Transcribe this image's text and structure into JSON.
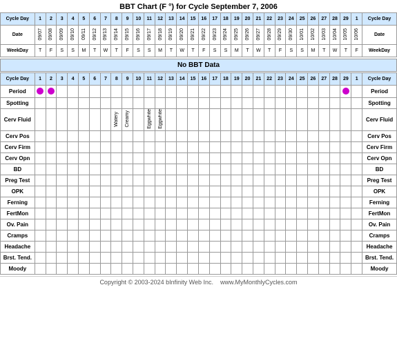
{
  "title": "BBT Chart (F °) for Cycle September 7, 2006",
  "top_section": {
    "cycle_day_label": "Cycle Day",
    "date_label": "Date",
    "weekday_label": "WeekDay",
    "cycle_days": [
      "1",
      "2",
      "3",
      "4",
      "5",
      "6",
      "7",
      "8",
      "9",
      "10",
      "11",
      "12",
      "13",
      "14",
      "15",
      "16",
      "17",
      "18",
      "19",
      "20",
      "21",
      "22",
      "23",
      "24",
      "25",
      "26",
      "27",
      "28",
      "29",
      "1"
    ],
    "dates": [
      "09/07",
      "09/08",
      "09/09",
      "09/10",
      "09/11",
      "09/12",
      "09/13",
      "09/14",
      "09/15",
      "09/16",
      "09/17",
      "09/18",
      "09/19",
      "09/20",
      "09/21",
      "09/22",
      "09/23",
      "09/24",
      "09/25",
      "09/26",
      "09/27",
      "09/28",
      "09/29",
      "09/30",
      "10/01",
      "10/02",
      "10/03",
      "10/04",
      "10/05",
      "10/06"
    ],
    "weekdays": [
      "T",
      "F",
      "S",
      "S",
      "M",
      "T",
      "W",
      "T",
      "F",
      "S",
      "S",
      "M",
      "T",
      "W",
      "T",
      "F",
      "S",
      "S",
      "M",
      "T",
      "W",
      "T",
      "F",
      "S",
      "S",
      "M",
      "T",
      "W",
      "T",
      "F"
    ]
  },
  "no_bbt": "No BBT Data",
  "bottom_section": {
    "cycle_days": [
      "1",
      "2",
      "3",
      "4",
      "5",
      "6",
      "7",
      "8",
      "9",
      "10",
      "11",
      "12",
      "13",
      "14",
      "15",
      "16",
      "17",
      "18",
      "19",
      "20",
      "21",
      "22",
      "23",
      "24",
      "25",
      "26",
      "27",
      "28",
      "29",
      "1"
    ],
    "rows": {
      "period": {
        "label": "Period",
        "dots": [
          0,
          1
        ],
        "last_dot": 29
      },
      "spotting": {
        "label": "Spotting"
      },
      "cerv_fluid": {
        "label": "Cerv Fluid",
        "values": {
          "7": "Watery",
          "8": "Creamy",
          "10": "Eggwhite",
          "11": "Eggwhite"
        }
      },
      "cerv_pos": {
        "label": "Cerv Pos"
      },
      "cerv_firm": {
        "label": "Cerv Firm"
      },
      "cerv_opn": {
        "label": "Cerv Opn"
      },
      "bd": {
        "label": "BD"
      },
      "preg_test": {
        "label": "Preg Test"
      },
      "opk": {
        "label": "OPK"
      },
      "ferning": {
        "label": "Ferning"
      },
      "fertmon": {
        "label": "FertMon"
      },
      "ov_pain": {
        "label": "Ov. Pain"
      },
      "cramps": {
        "label": "Cramps"
      },
      "headache": {
        "label": "Headache"
      },
      "brst_tend": {
        "label": "Brst. Tend."
      },
      "moody": {
        "label": "Moody"
      }
    }
  },
  "footer": {
    "copyright": "Copyright © 2003-2024 bInfinity Web Inc.",
    "website": "www.MyMonthlyCycles.com"
  }
}
